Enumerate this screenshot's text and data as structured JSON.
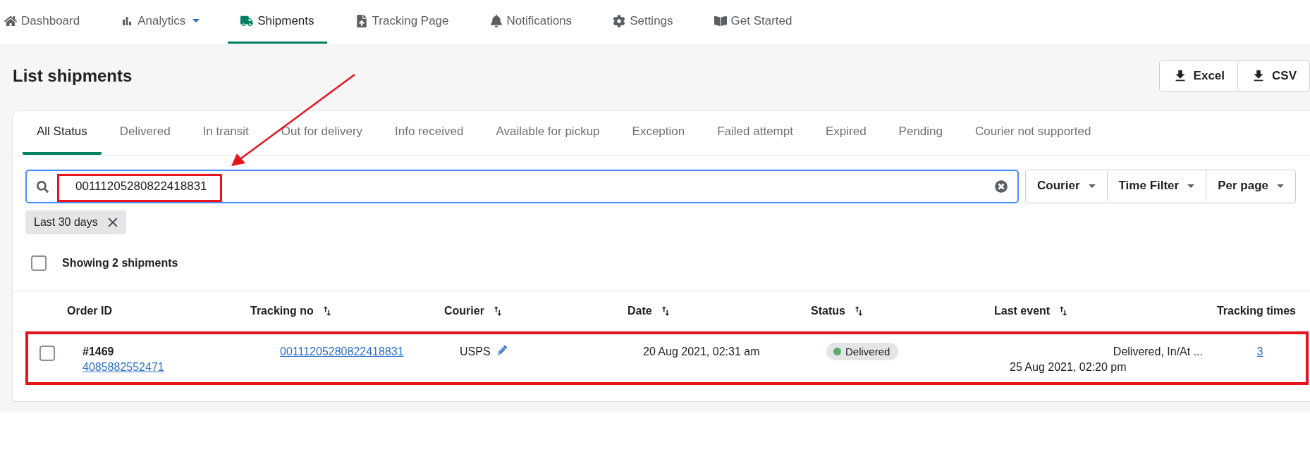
{
  "nav": [
    {
      "label": "Dashboard",
      "selected": false,
      "has_menu": false
    },
    {
      "label": "Analytics",
      "selected": false,
      "has_menu": true
    },
    {
      "label": "Shipments",
      "selected": true,
      "has_menu": false
    },
    {
      "label": "Tracking Page",
      "selected": false,
      "has_menu": false
    },
    {
      "label": "Notifications",
      "selected": false,
      "has_menu": false
    },
    {
      "label": "Settings",
      "selected": false,
      "has_menu": false
    },
    {
      "label": "Get Started",
      "selected": false,
      "has_menu": false
    }
  ],
  "page_title": "List shipments",
  "exports": [
    "Excel",
    "CSV"
  ],
  "tabs": [
    {
      "label": "All Status",
      "selected": true
    },
    {
      "label": "Delivered",
      "selected": false
    },
    {
      "label": "In transit",
      "selected": false
    },
    {
      "label": "Out for delivery",
      "selected": false
    },
    {
      "label": "Info received",
      "selected": false
    },
    {
      "label": "Available for pickup",
      "selected": false
    },
    {
      "label": "Exception",
      "selected": false
    },
    {
      "label": "Failed attempt",
      "selected": false
    },
    {
      "label": "Expired",
      "selected": false
    },
    {
      "label": "Pending",
      "selected": false
    },
    {
      "label": "Courier not supported",
      "selected": false
    }
  ],
  "search": {
    "value": "00111205280822418831",
    "highlighted": true
  },
  "filters": [
    "Courier",
    "Time Filter",
    "Per page"
  ],
  "chips": [
    "Last 30 days"
  ],
  "select_all": {
    "checked": false,
    "label": "Showing 2 shipments"
  },
  "columns": [
    {
      "label": "Order ID",
      "sortable": false
    },
    {
      "label": "Tracking no",
      "sortable": true
    },
    {
      "label": "Courier",
      "sortable": true
    },
    {
      "label": "Date",
      "sortable": true
    },
    {
      "label": "Status",
      "sortable": true
    },
    {
      "label": "Last event",
      "sortable": true
    },
    {
      "label": "Tracking times",
      "sortable": false
    }
  ],
  "rows": [
    {
      "checked": false,
      "highlighted": true,
      "order_number": "#1469",
      "order_id": "4085882552471",
      "tracking_no": "00111205280822418831",
      "courier": "USPS",
      "date": "20 Aug 2021, 02:31 am",
      "status": {
        "label": "Delivered",
        "color": "#5aac6b"
      },
      "last_event": "Delivered, In/At ...",
      "last_event_time": "25 Aug 2021, 02:20 pm",
      "tracking_times": "3"
    }
  ]
}
